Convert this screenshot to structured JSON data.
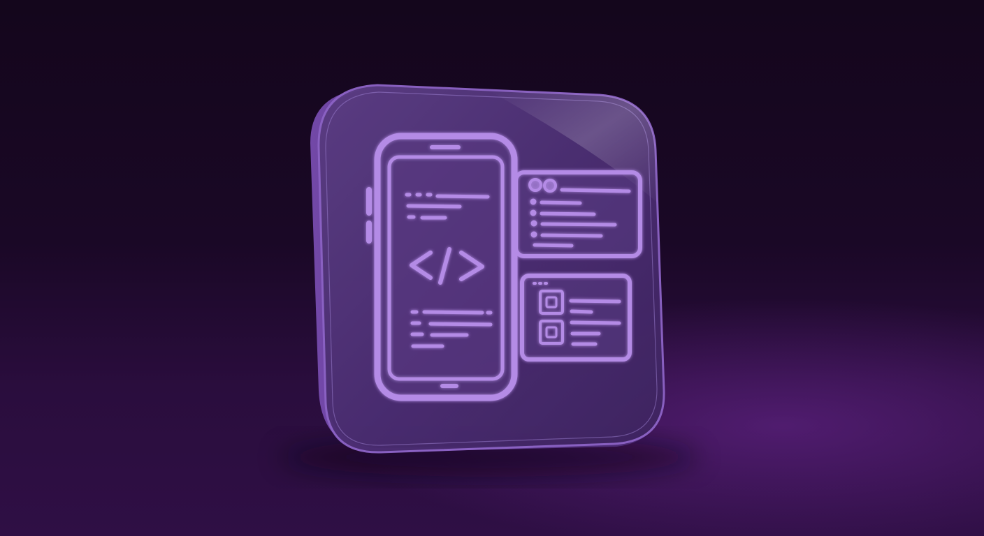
{
  "scene": {
    "subject": "app-icon",
    "colors": {
      "background_top": "#14061c",
      "background_bottom": "#2f0f45",
      "glass": "#5b3a86",
      "glass_edge": "#8a5cc4",
      "line_glow": "#b98ce8",
      "line_core": "#a77ddc"
    },
    "icons": [
      "smartphone-icon",
      "code-brackets-icon",
      "browser-window-icon",
      "card-list-icon"
    ],
    "code_symbol": "</>"
  }
}
